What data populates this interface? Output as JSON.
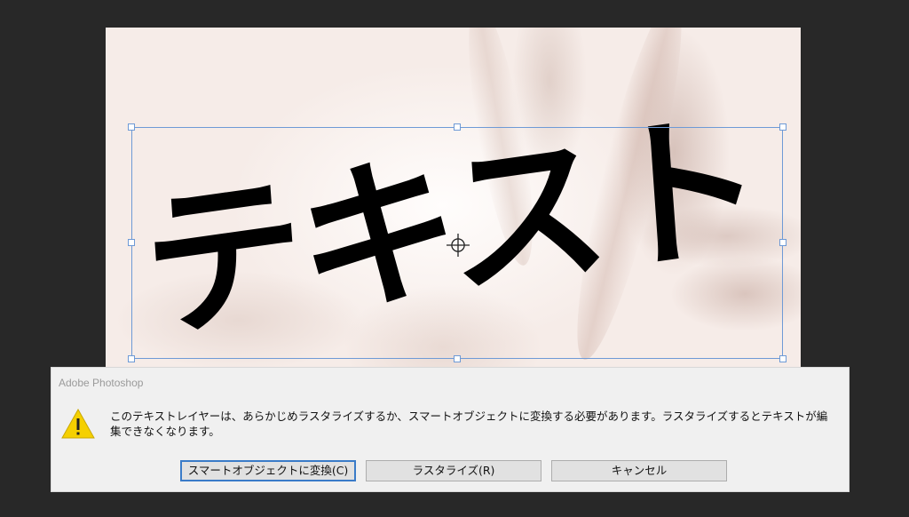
{
  "canvas": {
    "layer_text": "テキスト"
  },
  "dialog": {
    "title": "Adobe Photoshop",
    "message": "このテキストレイヤーは、あらかじめラスタライズするか、スマートオブジェクトに変換する必要があります。ラスタライズするとテキストが編集できなくなります。",
    "buttons": {
      "convert": "スマートオブジェクトに変換(C)",
      "rasterize": "ラスタライズ(R)",
      "cancel": "キャンセル"
    },
    "icon": "warning-icon"
  },
  "colors": {
    "workspace": "#282828",
    "selection": "#6e9ad6",
    "dialog_bg": "#f0f0f0",
    "warning": "#f5d000"
  }
}
